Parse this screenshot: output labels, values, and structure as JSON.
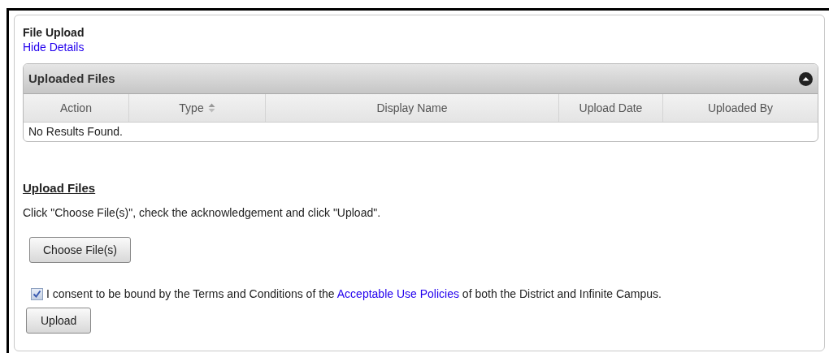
{
  "title": "File Upload",
  "details_link": "Hide Details",
  "uploaded_files": {
    "title": "Uploaded Files",
    "expanded": true,
    "columns": [
      {
        "label": "Action",
        "sortable": false
      },
      {
        "label": "Type",
        "sortable": true
      },
      {
        "label": "Display Name",
        "sortable": false
      },
      {
        "label": "Upload Date",
        "sortable": false
      },
      {
        "label": "Uploaded By",
        "sortable": false
      }
    ],
    "empty_message": "No Results Found."
  },
  "upload": {
    "heading": "Upload Files",
    "instructions": "Click \"Choose File(s)\", check the acknowledgement and click \"Upload\".",
    "choose_button": "Choose File(s)",
    "consent": {
      "checked": true,
      "text_before": "I consent to be bound by the Terms and Conditions of the",
      "link": "Acceptable Use Policies",
      "text_after": "of both the District and Infinite Campus."
    },
    "upload_button": "Upload"
  }
}
